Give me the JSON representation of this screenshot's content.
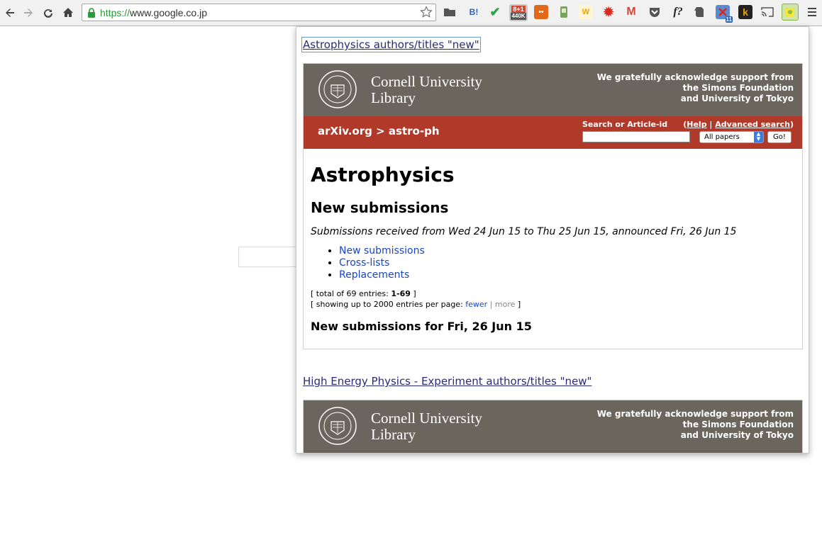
{
  "browser": {
    "address_scheme": "https://",
    "address_rest": "www.google.co.jp",
    "extensions": [
      {
        "name": "bookmark-folder-icon",
        "label": ""
      },
      {
        "name": "hatena-bookmark-icon",
        "label": "B!"
      },
      {
        "name": "check-icon",
        "label": "✔"
      },
      {
        "name": "google-plus-one-icon",
        "label": "8+1",
        "badge": "440K"
      },
      {
        "name": "orange-ext-icon",
        "label": "••"
      },
      {
        "name": "green-ext-icon",
        "label": ""
      },
      {
        "name": "w-ext-icon",
        "label": "W"
      },
      {
        "name": "red-splat-icon",
        "label": "✹"
      },
      {
        "name": "gmail-icon",
        "label": "M"
      },
      {
        "name": "pocket-icon",
        "label": ""
      },
      {
        "name": "formula-icon",
        "label": "f?"
      },
      {
        "name": "evernote-icon",
        "label": ""
      },
      {
        "name": "blocked-ext-icon",
        "label": "",
        "badge": "11"
      },
      {
        "name": "k-ext-icon",
        "label": "k"
      },
      {
        "name": "cast-icon",
        "label": ""
      },
      {
        "name": "rss-reader-icon",
        "label": ""
      }
    ]
  },
  "popup": {
    "feeds": [
      {
        "title": "Astrophysics authors/titles \"new\""
      },
      {
        "title": "High Energy Physics - Experiment authors/titles \"new\""
      }
    ],
    "library_name_line1": "Cornell University",
    "library_name_line2": "Library",
    "support_line1": "We gratefully acknowledge support from",
    "support_line2": "the Simons Foundation",
    "support_line3": "and University of Tokyo",
    "breadcrumb": "arXiv.org > astro-ph",
    "search_label": "Search or Article-id",
    "help_paren_open": "(",
    "help_label": "Help",
    "help_sep": " | ",
    "advanced_label": "Advanced search",
    "help_paren_close": ")",
    "select_value": "All papers",
    "go_label": "Go!",
    "page_title": "Astrophysics",
    "section_title": "New submissions",
    "received_text": "Submissions received from Wed 24 Jun 15 to Thu 25 Jun 15, announced Fri, 26 Jun 15",
    "nav_links": [
      "New submissions",
      "Cross-lists",
      "Replacements"
    ],
    "totals_prefix": "[ total of 69 entries: ",
    "totals_range": "1-69",
    "totals_suffix": " ]",
    "showing_prefix": "[ showing up to 2000 entries per page: ",
    "fewer_label": "fewer",
    "pipe": " | ",
    "more_label": "more",
    "showing_suffix": " ]",
    "subheading": "New submissions for Fri, 26 Jun 15"
  },
  "colors": {
    "cornell_gray": "#6a665d",
    "arxiv_red": "#b0392a",
    "link_blue": "#1946c2"
  }
}
